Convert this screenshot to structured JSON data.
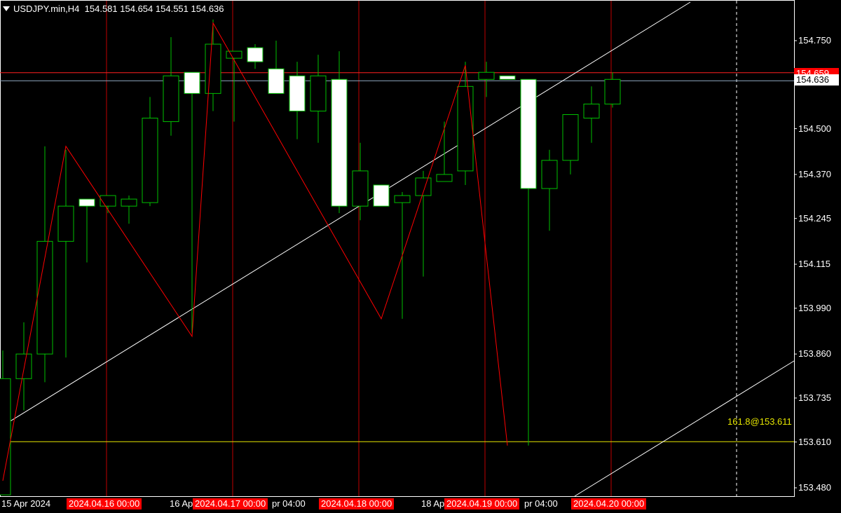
{
  "header": {
    "symbol": "USDJPY.min,H4",
    "open": "154.581",
    "high": "154.654",
    "low": "154.551",
    "close": "154.636"
  },
  "price_axis": {
    "labels": [
      "154.750",
      "154.500",
      "154.370",
      "154.245",
      "154.115",
      "153.990",
      "153.860",
      "153.735",
      "153.610",
      "153.480"
    ]
  },
  "current_price": {
    "bid": "154.636",
    "red_line_label": "154.659"
  },
  "time_axis": {
    "labels": [
      "15 Apr 2024",
      "16 Ap",
      "pr 04:00",
      "18 Ap",
      "pr 04:00"
    ]
  },
  "vertical_line_tags": [
    "2024.04.16 00:00",
    "2024.04.17 00:00",
    "2024.04.18 00:00",
    "2024.04.19 00:00",
    "2024.04.20 00:00"
  ],
  "fib_label": "161.8@153.611",
  "colors": {
    "bg": "#000000",
    "bull": "#00c000",
    "bear_fill": "#ffffff",
    "zigzag": "#ff0000",
    "vline": "#c00000",
    "trend": "#ffffff",
    "fib": "#e6e600",
    "bidline": "#8fa8c0"
  },
  "chart_data": {
    "type": "candlestick",
    "symbol": "USDJPY.min",
    "timeframe": "H4",
    "ylim": [
      153.43,
      154.86
    ],
    "candles": [
      {
        "o": 153.46,
        "h": 153.87,
        "l": 153.46,
        "c": 153.79
      },
      {
        "o": 153.79,
        "h": 153.95,
        "l": 153.7,
        "c": 153.86
      },
      {
        "o": 153.86,
        "h": 154.45,
        "l": 153.78,
        "c": 154.18
      },
      {
        "o": 154.18,
        "h": 154.44,
        "l": 153.85,
        "c": 154.28
      },
      {
        "o": 154.3,
        "h": 154.3,
        "l": 154.12,
        "c": 154.28
      },
      {
        "o": 154.28,
        "h": 154.31,
        "l": 154.26,
        "c": 154.31
      },
      {
        "o": 154.28,
        "h": 154.31,
        "l": 154.23,
        "c": 154.3
      },
      {
        "o": 154.29,
        "h": 154.59,
        "l": 154.28,
        "c": 154.53
      },
      {
        "o": 154.52,
        "h": 154.76,
        "l": 154.48,
        "c": 154.65
      },
      {
        "o": 154.66,
        "h": 154.66,
        "l": 153.92,
        "c": 154.6
      },
      {
        "o": 154.6,
        "h": 154.81,
        "l": 154.55,
        "c": 154.74
      },
      {
        "o": 154.7,
        "h": 154.72,
        "l": 154.52,
        "c": 154.72
      },
      {
        "o": 154.73,
        "h": 154.74,
        "l": 154.67,
        "c": 154.69
      },
      {
        "o": 154.67,
        "h": 154.75,
        "l": 154.66,
        "c": 154.6
      },
      {
        "o": 154.65,
        "h": 154.69,
        "l": 154.47,
        "c": 154.55
      },
      {
        "o": 154.55,
        "h": 154.71,
        "l": 154.46,
        "c": 154.65
      },
      {
        "o": 154.64,
        "h": 154.72,
        "l": 154.26,
        "c": 154.28
      },
      {
        "o": 154.28,
        "h": 154.46,
        "l": 154.24,
        "c": 154.38
      },
      {
        "o": 154.34,
        "h": 154.34,
        "l": 154.28,
        "c": 154.28
      },
      {
        "o": 154.29,
        "h": 154.32,
        "l": 153.96,
        "c": 154.31
      },
      {
        "o": 154.31,
        "h": 154.38,
        "l": 154.08,
        "c": 154.36
      },
      {
        "o": 154.35,
        "h": 154.52,
        "l": 154.36,
        "c": 154.37
      },
      {
        "o": 154.38,
        "h": 154.69,
        "l": 154.34,
        "c": 154.62
      },
      {
        "o": 154.64,
        "h": 154.69,
        "l": 154.59,
        "c": 154.66
      },
      {
        "o": 154.65,
        "h": 154.65,
        "l": 154.64,
        "c": 154.64
      },
      {
        "o": 154.64,
        "h": 154.64,
        "l": 153.6,
        "c": 154.33
      },
      {
        "o": 154.33,
        "h": 154.44,
        "l": 154.21,
        "c": 154.41
      },
      {
        "o": 154.41,
        "h": 154.54,
        "l": 154.37,
        "c": 154.54
      },
      {
        "o": 154.53,
        "h": 154.62,
        "l": 154.46,
        "c": 154.57
      },
      {
        "o": 154.57,
        "h": 154.66,
        "l": 154.56,
        "c": 154.64
      }
    ],
    "zigzag": [
      {
        "i": 0,
        "p": 153.5
      },
      {
        "i": 3,
        "p": 154.45
      },
      {
        "i": 9,
        "p": 153.91
      },
      {
        "i": 10,
        "p": 154.8
      },
      {
        "i": 18,
        "p": 153.96
      },
      {
        "i": 22,
        "p": 154.68
      },
      {
        "i": 24,
        "p": 153.6
      },
      {
        "i": 24,
        "p": 153.6
      }
    ],
    "horizontal_levels": [
      {
        "name": "red-level",
        "price": 154.659
      },
      {
        "name": "bid-level",
        "price": 154.636
      },
      {
        "name": "fib-161.8",
        "price": 153.611
      }
    ]
  }
}
